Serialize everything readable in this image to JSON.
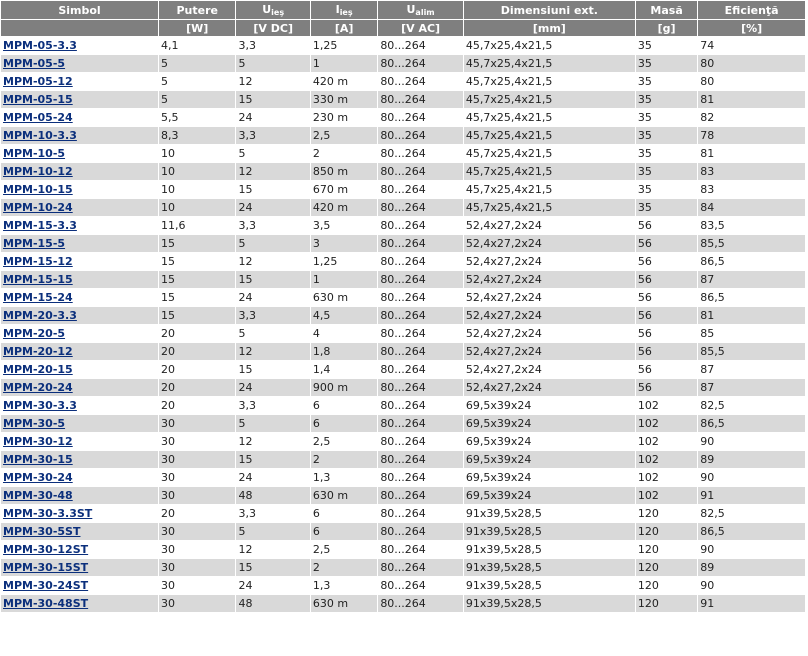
{
  "headers": [
    {
      "label": "Simbol",
      "sub": "",
      "unit": ""
    },
    {
      "label": "Putere",
      "sub": "",
      "unit": "[W]"
    },
    {
      "label": "U",
      "sub": "ieş",
      "unit": "[V DC]"
    },
    {
      "label": "I",
      "sub": "ieş",
      "unit": "[A]"
    },
    {
      "label": "U",
      "sub": "alim",
      "unit": "[V AC]"
    },
    {
      "label": "Dimensiuni ext.",
      "sub": "",
      "unit": "[mm]"
    },
    {
      "label": "Masă",
      "sub": "",
      "unit": "[g]"
    },
    {
      "label": "Eficienţă",
      "sub": "",
      "unit": "[%]"
    }
  ],
  "rows": [
    [
      "MPM-05-3.3",
      "4,1",
      "3,3",
      "1,25",
      "80...264",
      "45,7x25,4x21,5",
      "35",
      "74"
    ],
    [
      "MPM-05-5",
      "5",
      "5",
      "1",
      "80...264",
      "45,7x25,4x21,5",
      "35",
      "80"
    ],
    [
      "MPM-05-12",
      "5",
      "12",
      "420 m",
      "80...264",
      "45,7x25,4x21,5",
      "35",
      "80"
    ],
    [
      "MPM-05-15",
      "5",
      "15",
      "330 m",
      "80...264",
      "45,7x25,4x21,5",
      "35",
      "81"
    ],
    [
      "MPM-05-24",
      "5,5",
      "24",
      "230 m",
      "80...264",
      "45,7x25,4x21,5",
      "35",
      "82"
    ],
    [
      "MPM-10-3.3",
      "8,3",
      "3,3",
      "2,5",
      "80...264",
      "45,7x25,4x21,5",
      "35",
      "78"
    ],
    [
      "MPM-10-5",
      "10",
      "5",
      "2",
      "80...264",
      "45,7x25,4x21,5",
      "35",
      "81"
    ],
    [
      "MPM-10-12",
      "10",
      "12",
      "850 m",
      "80...264",
      "45,7x25,4x21,5",
      "35",
      "83"
    ],
    [
      "MPM-10-15",
      "10",
      "15",
      "670 m",
      "80...264",
      "45,7x25,4x21,5",
      "35",
      "83"
    ],
    [
      "MPM-10-24",
      "10",
      "24",
      "420 m",
      "80...264",
      "45,7x25,4x21,5",
      "35",
      "84"
    ],
    [
      "MPM-15-3.3",
      "11,6",
      "3,3",
      "3,5",
      "80...264",
      "52,4x27,2x24",
      "56",
      "83,5"
    ],
    [
      "MPM-15-5",
      "15",
      "5",
      "3",
      "80...264",
      "52,4x27,2x24",
      "56",
      "85,5"
    ],
    [
      "MPM-15-12",
      "15",
      "12",
      "1,25",
      "80...264",
      "52,4x27,2x24",
      "56",
      "86,5"
    ],
    [
      "MPM-15-15",
      "15",
      "15",
      "1",
      "80...264",
      "52,4x27,2x24",
      "56",
      "87"
    ],
    [
      "MPM-15-24",
      "15",
      "24",
      "630 m",
      "80...264",
      "52,4x27,2x24",
      "56",
      "86,5"
    ],
    [
      "MPM-20-3.3",
      "15",
      "3,3",
      "4,5",
      "80...264",
      "52,4x27,2x24",
      "56",
      "81"
    ],
    [
      "MPM-20-5",
      "20",
      "5",
      "4",
      "80...264",
      "52,4x27,2x24",
      "56",
      "85"
    ],
    [
      "MPM-20-12",
      "20",
      "12",
      "1,8",
      "80...264",
      "52,4x27,2x24",
      "56",
      "85,5"
    ],
    [
      "MPM-20-15",
      "20",
      "15",
      "1,4",
      "80...264",
      "52,4x27,2x24",
      "56",
      "87"
    ],
    [
      "MPM-20-24",
      "20",
      "24",
      "900 m",
      "80...264",
      "52,4x27,2x24",
      "56",
      "87"
    ],
    [
      "MPM-30-3.3",
      "20",
      "3,3",
      "6",
      "80...264",
      "69,5x39x24",
      "102",
      "82,5"
    ],
    [
      "MPM-30-5",
      "30",
      "5",
      "6",
      "80...264",
      "69,5x39x24",
      "102",
      "86,5"
    ],
    [
      "MPM-30-12",
      "30",
      "12",
      "2,5",
      "80...264",
      "69,5x39x24",
      "102",
      "90"
    ],
    [
      "MPM-30-15",
      "30",
      "15",
      "2",
      "80...264",
      "69,5x39x24",
      "102",
      "89"
    ],
    [
      "MPM-30-24",
      "30",
      "24",
      "1,3",
      "80...264",
      "69,5x39x24",
      "102",
      "90"
    ],
    [
      "MPM-30-48",
      "30",
      "48",
      "630 m",
      "80...264",
      "69,5x39x24",
      "102",
      "91"
    ],
    [
      "MPM-30-3.3ST",
      "20",
      "3,3",
      "6",
      "80...264",
      "91x39,5x28,5",
      "120",
      "82,5"
    ],
    [
      "MPM-30-5ST",
      "30",
      "5",
      "6",
      "80...264",
      "91x39,5x28,5",
      "120",
      "86,5"
    ],
    [
      "MPM-30-12ST",
      "30",
      "12",
      "2,5",
      "80...264",
      "91x39,5x28,5",
      "120",
      "90"
    ],
    [
      "MPM-30-15ST",
      "30",
      "15",
      "2",
      "80...264",
      "91x39,5x28,5",
      "120",
      "89"
    ],
    [
      "MPM-30-24ST",
      "30",
      "24",
      "1,3",
      "80...264",
      "91x39,5x28,5",
      "120",
      "90"
    ],
    [
      "MPM-30-48ST",
      "30",
      "48",
      "630 m",
      "80...264",
      "91x39,5x28,5",
      "120",
      "91"
    ]
  ]
}
